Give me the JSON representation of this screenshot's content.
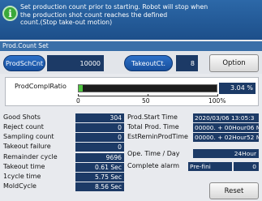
{
  "banner": {
    "icon": "info-icon",
    "text": "Set production count prior to starting. Robot will stop when\n the production shot count reaches the defined\n count.(Stop take-out motion)"
  },
  "section": {
    "title": "Prod.Count Set"
  },
  "top_row": {
    "prod_sch_cnt_label": "ProdSchCnt",
    "prod_sch_cnt_value": "10000",
    "takeout_ct_label": "TakeoutCt.",
    "takeout_ct_value": "8",
    "option_label": "Option"
  },
  "progress": {
    "label": "ProdComplRatio",
    "percent": 3.04,
    "readout": "3.04 %",
    "scale": [
      "0",
      "50",
      "100%"
    ]
  },
  "stats_left": [
    {
      "label": "Good Shots",
      "value": "304"
    },
    {
      "label": "Reject count",
      "value": "0"
    },
    {
      "label": "Sampling count",
      "value": "0"
    },
    {
      "label": "Takeout failure",
      "value": "0"
    },
    {
      "label": "Remainder cycle",
      "value": "9696"
    },
    {
      "label": "Takeout time",
      "value": "0.61 Sec"
    },
    {
      "label": "1cycle time",
      "value": "5.75 Sec"
    },
    {
      "label": "MoldCycle",
      "value": "8.56 Sec"
    }
  ],
  "stats_right": [
    {
      "label": "Prod.Start Time",
      "value": "2020/03/06 13:05:3"
    },
    {
      "label": "Total Prod. Time",
      "value": "00000. + 00Hour06 M"
    },
    {
      "label": "EstReminProdTime",
      "value": "00000. + 02Hour52 M"
    },
    {
      "label": "Ope. Time / Day",
      "value": "24Hour"
    },
    {
      "label": "Complete alarm",
      "value": "Pre-fini",
      "value2": "0"
    }
  ],
  "reset_label": "Reset"
}
